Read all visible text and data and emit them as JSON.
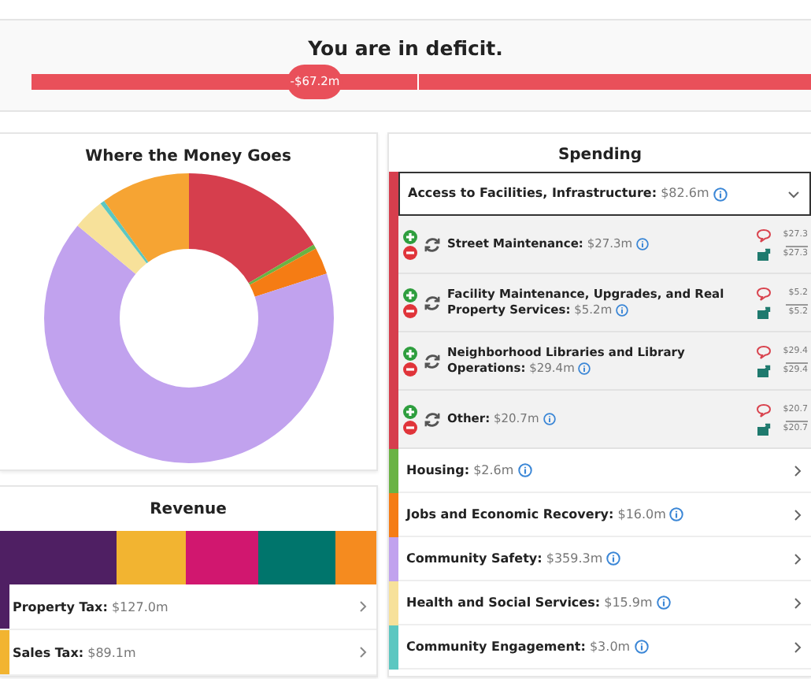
{
  "deficit": {
    "title": "You are in deficit.",
    "marker": "-$67.2m",
    "level": 0.36
  },
  "chart_panel": {
    "title": "Where the Money Goes"
  },
  "revenue": {
    "title": "Revenue",
    "items": [
      {
        "name": "Property Tax:",
        "amount": "$127.0m",
        "color": "#4f1f63"
      },
      {
        "name": "Sales Tax:",
        "amount": "$89.1m",
        "color": "#f2b431"
      }
    ]
  },
  "spending": {
    "title": "Spending",
    "categories": [
      {
        "name": "Access to Facilities, Infrastructure:",
        "amount": "$82.6m",
        "color": "#d63e4d",
        "expanded": true,
        "children": [
          {
            "name": "Street Maintenance:",
            "amount": "$27.3m",
            "column_1": "$27.3",
            "column_2": "$27.3"
          },
          {
            "name": "Facility Maintenance, Upgrades, and Real Property Services:",
            "amount": "$5.2m",
            "column_1": "$5.2",
            "column_2": "$5.2"
          },
          {
            "name": "Neighborhood Libraries and Library Operations:",
            "amount": "$29.4m",
            "column_1": "$29.4",
            "column_2": "$29.4"
          },
          {
            "name": "Other:",
            "amount": "$20.7m",
            "column_1": "$20.7",
            "column_2": "$20.7"
          }
        ]
      },
      {
        "name": "Housing:",
        "amount": "$2.6m",
        "color": "#6ab344",
        "expanded": false
      },
      {
        "name": "Jobs and Economic Recovery:",
        "amount": "$16.0m",
        "color": "#f57c14",
        "expanded": false
      },
      {
        "name": "Community Safety:",
        "amount": "$359.3m",
        "color": "#c1a2ee",
        "expanded": false
      },
      {
        "name": "Health and Social Services:",
        "amount": "$15.9m",
        "color": "#f7e19a",
        "expanded": false
      },
      {
        "name": "Community Engagement:",
        "amount": "$3.0m",
        "color": "#5cc7c1",
        "expanded": false
      }
    ]
  }
}
